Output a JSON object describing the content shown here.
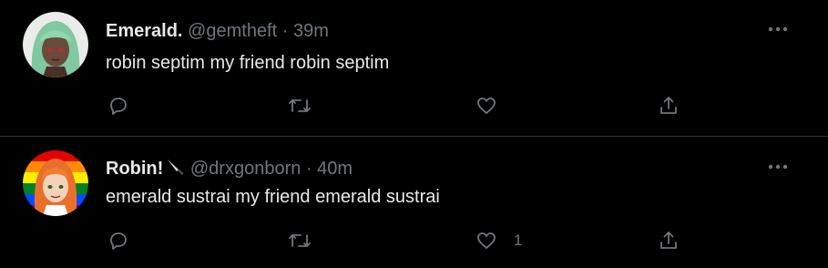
{
  "colors": {
    "background": "#000000",
    "divider": "#2f3336",
    "primary_text": "#e7e9ea",
    "secondary_text": "#71767b"
  },
  "tweets": [
    {
      "display_name": "Emerald.",
      "handle": "@gemtheft",
      "separator": "·",
      "time": "39m",
      "text": "robin septim my friend robin septim",
      "avatar_icon": "green-haired-character-avatar",
      "like_count": ""
    },
    {
      "display_name": "Robin!",
      "name_emoji": "knife-emoji",
      "handle": "@drxgonborn",
      "separator": "·",
      "time": "40m",
      "text": "emerald sustrai my friend emerald sustrai",
      "avatar_icon": "orange-haired-character-pride-flag-avatar",
      "like_count": "1"
    }
  ]
}
